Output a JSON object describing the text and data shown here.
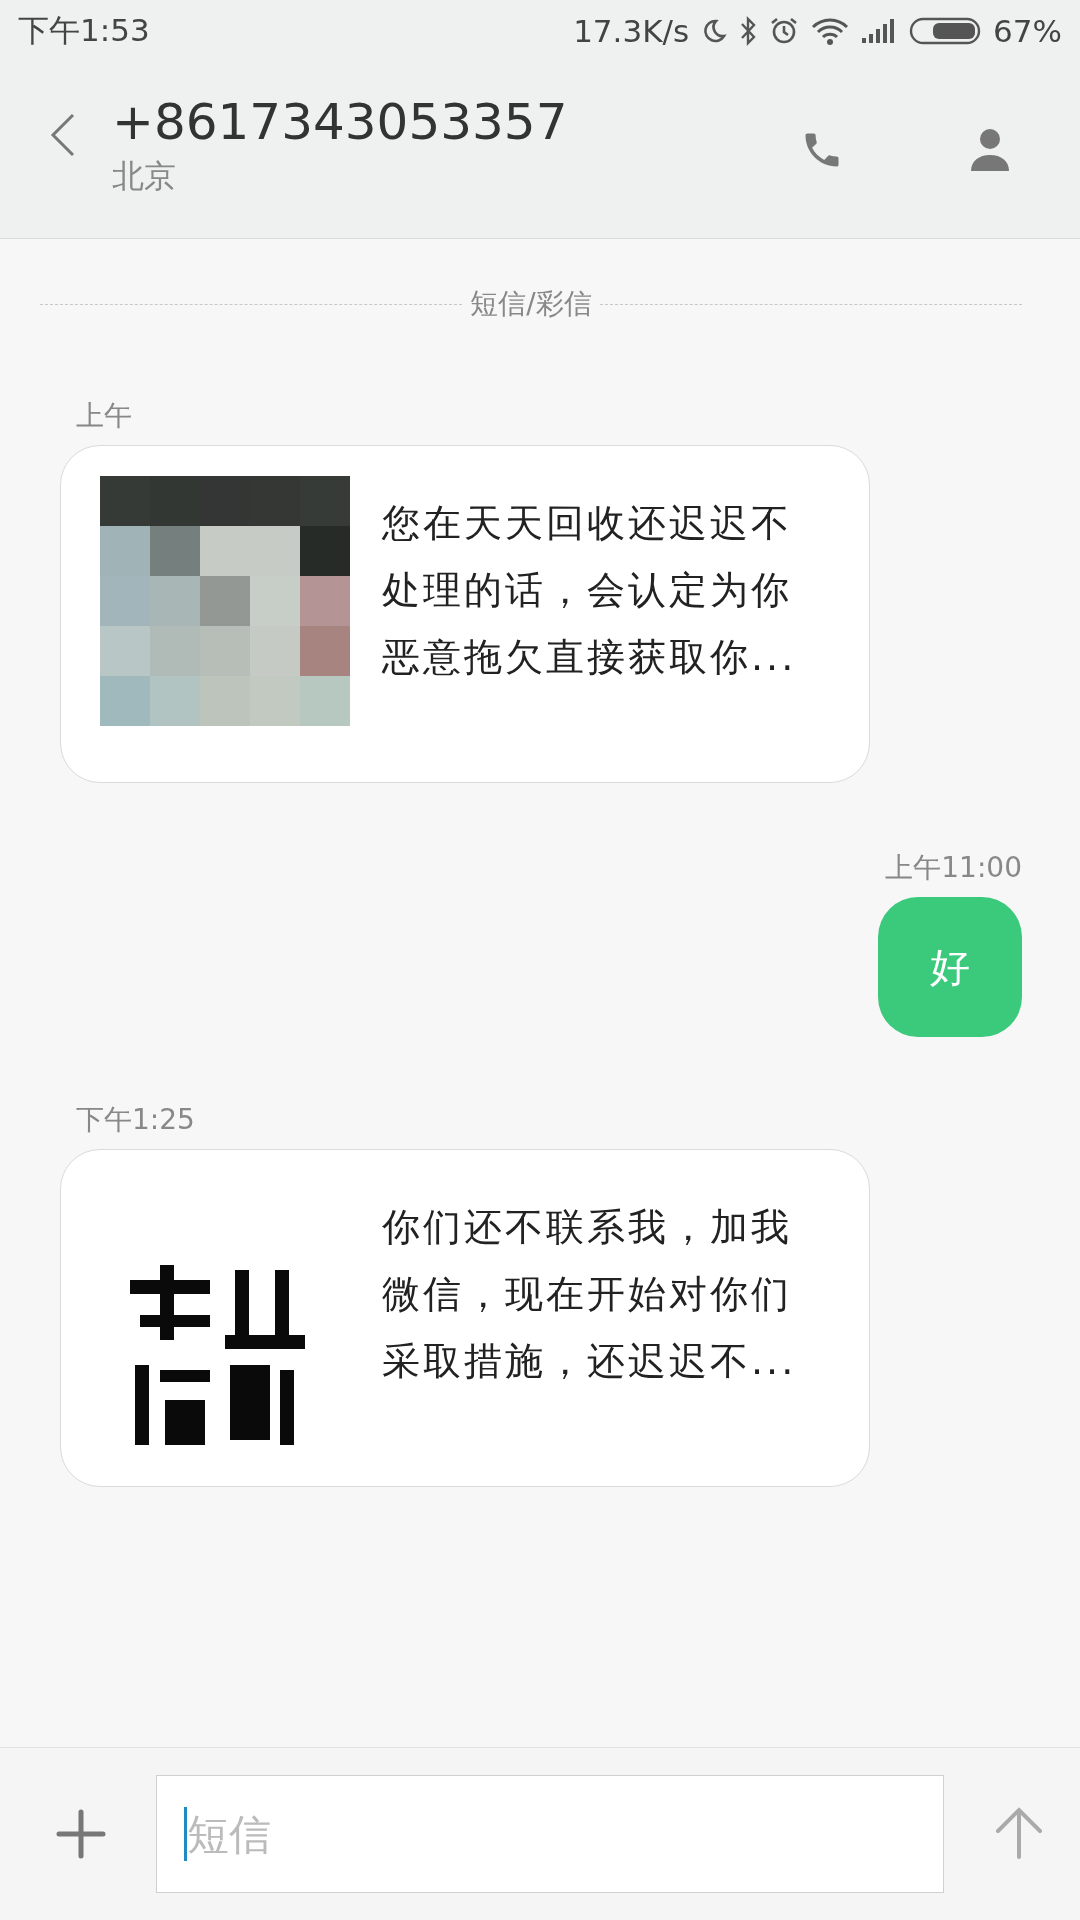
{
  "status_bar": {
    "time": "下午1:53",
    "net_speed": "17.3K/s",
    "battery": "67%"
  },
  "header": {
    "title": "+8617343053357",
    "subtitle": "北京"
  },
  "divider_label": "短信/彩信",
  "messages": [
    {
      "kind": "received",
      "time": "上午",
      "text": "您在天天回收还迟迟不处理的话，会认定为你恶意拖欠直接获取你..."
    },
    {
      "kind": "sent",
      "time": "上午11:00",
      "text": "好"
    },
    {
      "kind": "received",
      "time": "下午1:25",
      "text": "你们还不联系我，加我微信，现在开始对你们采取措施，还迟迟不..."
    }
  ],
  "composer": {
    "placeholder": "短信"
  }
}
